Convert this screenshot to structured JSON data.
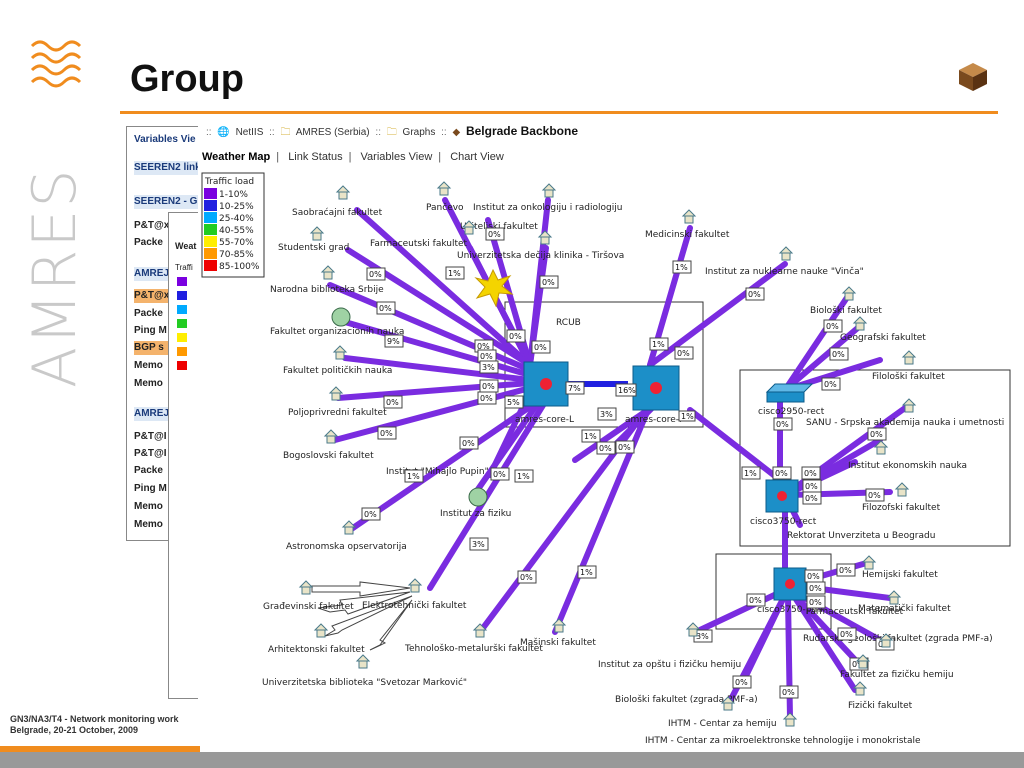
{
  "slide": {
    "title": "Group",
    "brand": "AMRES",
    "footer_line1": "GN3/NA3/T4 - Network monitoring work",
    "footer_line2": "Belgrade, 20-21 October, 2009",
    "accent_color": "#f08c1e"
  },
  "back_panel": {
    "rows": [
      "Variables Vie",
      "SEEREN2 link",
      "SEEREN2 - GF",
      "P&T@x",
      "Packe",
      "AMREJ",
      "P&T@x",
      "Packe",
      "Ping M",
      "BGP s",
      "Memo",
      "Memo",
      "AMREJ",
      "P&T@I",
      "P&T@I",
      "Packe",
      "Ping M",
      "Memo",
      "Memo"
    ]
  },
  "mid_panel": {
    "header": "Weat",
    "legend_label": "Traffi"
  },
  "breadcrumb": {
    "items": [
      "NetIIS",
      "AMRES (Serbia)",
      "Graphs"
    ],
    "current": "Belgrade Backbone"
  },
  "tabs": {
    "active": "Weather Map",
    "items": [
      "Link Status",
      "Variables View",
      "Chart View"
    ]
  },
  "legend": {
    "title": "Traffic load",
    "items": [
      {
        "label": "1-10%",
        "color": "#7a00e0"
      },
      {
        "label": "10-25%",
        "color": "#2020e0"
      },
      {
        "label": "25-40%",
        "color": "#00aaff"
      },
      {
        "label": "40-55%",
        "color": "#22cc22"
      },
      {
        "label": "55-70%",
        "color": "#ffee00"
      },
      {
        "label": "70-85%",
        "color": "#ff9900"
      },
      {
        "label": "85-100%",
        "color": "#ee0000"
      }
    ]
  },
  "groups": {
    "rcub": "RCUB"
  },
  "routers": {
    "core_l": "amres-core-L",
    "core_p": "amres-core-P",
    "c2950": "cisco2950-rect",
    "c3750": "cisco3750-rect",
    "c3750pmf": "cisco3750-pmf"
  },
  "nodes": [
    "Saobraćajni fakultet",
    "Studentski grad",
    "Farmaceutski fakultet",
    "Pančevo",
    "Učiteljski fakultet",
    "Institut za onkologiju i radiologiju",
    "Univerzitetska dečija klinika - Tiršova",
    "Medicinski fakultet",
    "Institut za nuklearne nauke \"Vinča\"",
    "Narodna biblioteka Srbije",
    "Fakultet organizacionih nauka",
    "Fakultet političkih nauka",
    "Poljoprivredni fakultet",
    "Bogoslovski fakultet",
    "Institut \"Mihajlo Pupin\"",
    "Institut za fiziku",
    "Astronomska opservatorija",
    "Građevinski fakultet",
    "Elektrotehnički fakultet",
    "Arhitektonski fakultet",
    "Univerzitetska biblioteka \"Svetozar Marković\"",
    "Tehnološko-metalurški fakultet",
    "Mašinski fakultet",
    "Biološki fakultet",
    "Geografski fakultet",
    "Filološki fakultet",
    "SANU - Srpska akademija nauka i umetnosti",
    "Institut ekonomskih nauka",
    "Filozofski fakultet",
    "Rektorat Unverziteta u Beogradu",
    "Hemijski fakultet",
    "Matematički fakultet",
    "Rudarsko geološki fakultet (zgrada PMF-a)",
    "Fakultet za fizičku hemiju",
    "Fizički fakultet",
    "Institut za opštu i fizičku hemiju",
    "Biološki fakultet (zgrada PMF-a)",
    "IHTM - Centar za hemiju",
    "IHTM - Centar za mikroelektronske tehnologije i monokristale",
    "Farmaceutski fakultet"
  ],
  "percents": {
    "p_saob": "0%",
    "p_stud": "0%",
    "p_farm": "1%",
    "p_panc": "0%",
    "p_ucit": "0%",
    "p_onko": "0%",
    "p_tirs": "0%",
    "p_med": "1%",
    "p_vinca": "0%",
    "p_nbs": "0%",
    "p_fon": "9%",
    "p_fpn": "3%",
    "p_polj": "0%",
    "p_bog": "0%",
    "p_pupin": "1%",
    "p_fiz": "1%",
    "p_astro": "0%",
    "p_etf": "3%",
    "p_tmf": "0%",
    "p_mas": "1%",
    "p_core_l": "7%",
    "p_core_p": "16%",
    "p_rcub1": "0%",
    "p_rcub2": "0%",
    "p_rcub3": "0%",
    "p_l1": "0%",
    "p_l2": "5%",
    "p_l3": "0%",
    "p_mid1": "3%",
    "p_mid2": "1%",
    "p_mid3": "0%",
    "p_mid4": "0%",
    "p_p1": "1%",
    "p_p2": "0%",
    "p_bio": "0%",
    "p_geo": "0%",
    "p_filo": "0%",
    "p_sanu": "0%",
    "p_ieko": "0%",
    "p_filoz": "0%",
    "p_rekt": "0%",
    "p_c2950": "0%",
    "p_c3750a": "0%",
    "p_c3750b": "1%",
    "p_hem": "0%",
    "p_mat": "0%",
    "p_rgf": "0%",
    "p_ffh": "0%",
    "p_fiz2": "0%",
    "p_iofh": "0%",
    "p_bio2": "0%",
    "p_ihtm1": "0%",
    "p_ihtm2": "0%",
    "p_pmf1": "0%",
    "p_pmf2": "0%",
    "p_pmf3": "0%"
  }
}
